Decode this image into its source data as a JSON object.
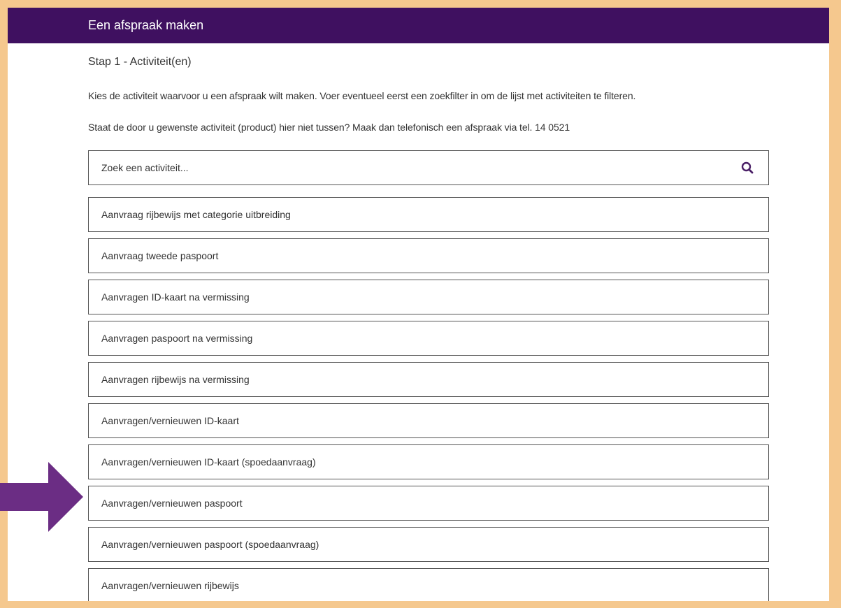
{
  "header": {
    "title": "Een afspraak maken"
  },
  "step": {
    "label": "Stap 1 - Activiteit(en)"
  },
  "instructions": {
    "intro": "Kies de activiteit waarvoor u een afspraak wilt maken. Voer eventueel eerst een zoekfilter in om de lijst met activiteiten te filteren.",
    "note": "Staat de door u gewenste activiteit (product) hier niet tussen? Maak dan telefonisch een afspraak via tel. 14 0521"
  },
  "search": {
    "placeholder": "Zoek een activiteit...",
    "icon": "search-icon"
  },
  "activities": [
    "Aanvraag rijbewijs met categorie uitbreiding",
    "Aanvraag tweede paspoort",
    "Aanvragen ID-kaart na vermissing",
    "Aanvragen paspoort na vermissing",
    "Aanvragen rijbewijs na vermissing",
    "Aanvragen/vernieuwen ID-kaart",
    "Aanvragen/vernieuwen ID-kaart (spoedaanvraag)",
    "Aanvragen/vernieuwen paspoort",
    "Aanvragen/vernieuwen paspoort (spoedaanvraag)",
    "Aanvragen/vernieuwen rijbewijs"
  ],
  "colors": {
    "header_bg": "#3f1060",
    "accent_purple": "#6b2d84",
    "frame_border": "#f5c88e"
  }
}
